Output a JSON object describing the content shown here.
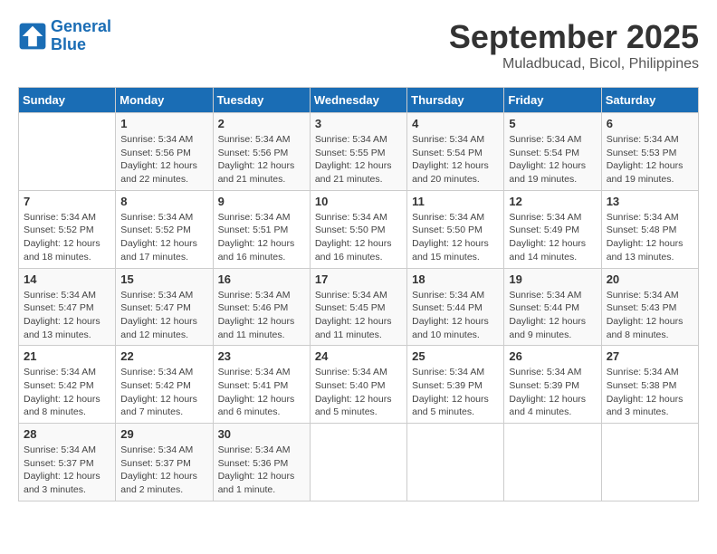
{
  "header": {
    "logo_line1": "General",
    "logo_line2": "Blue",
    "month": "September 2025",
    "location": "Muladbucad, Bicol, Philippines"
  },
  "weekdays": [
    "Sunday",
    "Monday",
    "Tuesday",
    "Wednesday",
    "Thursday",
    "Friday",
    "Saturday"
  ],
  "weeks": [
    [
      {
        "day": "",
        "info": ""
      },
      {
        "day": "1",
        "info": "Sunrise: 5:34 AM\nSunset: 5:56 PM\nDaylight: 12 hours\nand 22 minutes."
      },
      {
        "day": "2",
        "info": "Sunrise: 5:34 AM\nSunset: 5:56 PM\nDaylight: 12 hours\nand 21 minutes."
      },
      {
        "day": "3",
        "info": "Sunrise: 5:34 AM\nSunset: 5:55 PM\nDaylight: 12 hours\nand 21 minutes."
      },
      {
        "day": "4",
        "info": "Sunrise: 5:34 AM\nSunset: 5:54 PM\nDaylight: 12 hours\nand 20 minutes."
      },
      {
        "day": "5",
        "info": "Sunrise: 5:34 AM\nSunset: 5:54 PM\nDaylight: 12 hours\nand 19 minutes."
      },
      {
        "day": "6",
        "info": "Sunrise: 5:34 AM\nSunset: 5:53 PM\nDaylight: 12 hours\nand 19 minutes."
      }
    ],
    [
      {
        "day": "7",
        "info": "Sunrise: 5:34 AM\nSunset: 5:52 PM\nDaylight: 12 hours\nand 18 minutes."
      },
      {
        "day": "8",
        "info": "Sunrise: 5:34 AM\nSunset: 5:52 PM\nDaylight: 12 hours\nand 17 minutes."
      },
      {
        "day": "9",
        "info": "Sunrise: 5:34 AM\nSunset: 5:51 PM\nDaylight: 12 hours\nand 16 minutes."
      },
      {
        "day": "10",
        "info": "Sunrise: 5:34 AM\nSunset: 5:50 PM\nDaylight: 12 hours\nand 16 minutes."
      },
      {
        "day": "11",
        "info": "Sunrise: 5:34 AM\nSunset: 5:50 PM\nDaylight: 12 hours\nand 15 minutes."
      },
      {
        "day": "12",
        "info": "Sunrise: 5:34 AM\nSunset: 5:49 PM\nDaylight: 12 hours\nand 14 minutes."
      },
      {
        "day": "13",
        "info": "Sunrise: 5:34 AM\nSunset: 5:48 PM\nDaylight: 12 hours\nand 13 minutes."
      }
    ],
    [
      {
        "day": "14",
        "info": "Sunrise: 5:34 AM\nSunset: 5:47 PM\nDaylight: 12 hours\nand 13 minutes."
      },
      {
        "day": "15",
        "info": "Sunrise: 5:34 AM\nSunset: 5:47 PM\nDaylight: 12 hours\nand 12 minutes."
      },
      {
        "day": "16",
        "info": "Sunrise: 5:34 AM\nSunset: 5:46 PM\nDaylight: 12 hours\nand 11 minutes."
      },
      {
        "day": "17",
        "info": "Sunrise: 5:34 AM\nSunset: 5:45 PM\nDaylight: 12 hours\nand 11 minutes."
      },
      {
        "day": "18",
        "info": "Sunrise: 5:34 AM\nSunset: 5:44 PM\nDaylight: 12 hours\nand 10 minutes."
      },
      {
        "day": "19",
        "info": "Sunrise: 5:34 AM\nSunset: 5:44 PM\nDaylight: 12 hours\nand 9 minutes."
      },
      {
        "day": "20",
        "info": "Sunrise: 5:34 AM\nSunset: 5:43 PM\nDaylight: 12 hours\nand 8 minutes."
      }
    ],
    [
      {
        "day": "21",
        "info": "Sunrise: 5:34 AM\nSunset: 5:42 PM\nDaylight: 12 hours\nand 8 minutes."
      },
      {
        "day": "22",
        "info": "Sunrise: 5:34 AM\nSunset: 5:42 PM\nDaylight: 12 hours\nand 7 minutes."
      },
      {
        "day": "23",
        "info": "Sunrise: 5:34 AM\nSunset: 5:41 PM\nDaylight: 12 hours\nand 6 minutes."
      },
      {
        "day": "24",
        "info": "Sunrise: 5:34 AM\nSunset: 5:40 PM\nDaylight: 12 hours\nand 5 minutes."
      },
      {
        "day": "25",
        "info": "Sunrise: 5:34 AM\nSunset: 5:39 PM\nDaylight: 12 hours\nand 5 minutes."
      },
      {
        "day": "26",
        "info": "Sunrise: 5:34 AM\nSunset: 5:39 PM\nDaylight: 12 hours\nand 4 minutes."
      },
      {
        "day": "27",
        "info": "Sunrise: 5:34 AM\nSunset: 5:38 PM\nDaylight: 12 hours\nand 3 minutes."
      }
    ],
    [
      {
        "day": "28",
        "info": "Sunrise: 5:34 AM\nSunset: 5:37 PM\nDaylight: 12 hours\nand 3 minutes."
      },
      {
        "day": "29",
        "info": "Sunrise: 5:34 AM\nSunset: 5:37 PM\nDaylight: 12 hours\nand 2 minutes."
      },
      {
        "day": "30",
        "info": "Sunrise: 5:34 AM\nSunset: 5:36 PM\nDaylight: 12 hours\nand 1 minute."
      },
      {
        "day": "",
        "info": ""
      },
      {
        "day": "",
        "info": ""
      },
      {
        "day": "",
        "info": ""
      },
      {
        "day": "",
        "info": ""
      }
    ]
  ]
}
